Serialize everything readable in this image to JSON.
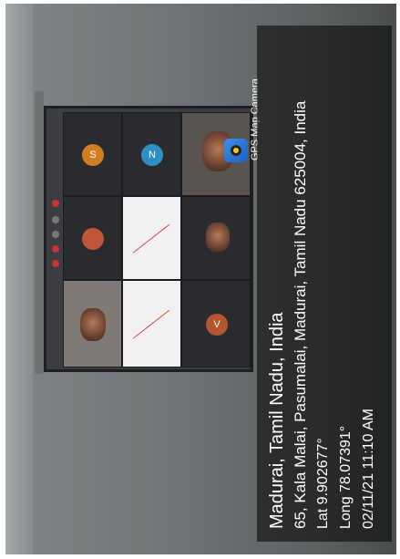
{
  "gps_badge": {
    "label": "GPS Map Camera",
    "icon": "gps-map-camera-app-icon"
  },
  "location": {
    "city_line": "Madurai, Tamil Nadu, India",
    "address": "65, Kala Malai, Pasumalai, Madurai, Tamil Nadu 625004, India",
    "lat": "Lat 9.902677°",
    "long": "Long 78.07391°",
    "datetime": "02/11/21 11:10 AM"
  },
  "screen": {
    "avatars": [
      {
        "initial": "V",
        "color": "#b5562e"
      },
      {
        "initial": "N",
        "color": "#2f8fc4"
      },
      {
        "initial": "S",
        "color": "#d27d22"
      }
    ]
  }
}
